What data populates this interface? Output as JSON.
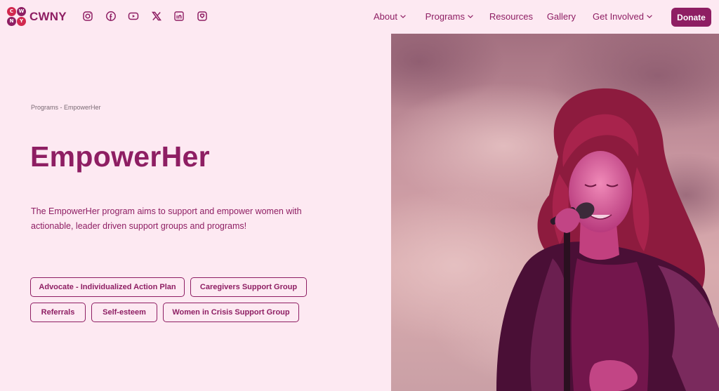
{
  "brand": {
    "name": "CWNY",
    "mark_letters": [
      "C",
      "W",
      "N",
      "Y"
    ],
    "colors": {
      "primary": "#8e1e63",
      "accent": "#d2284e",
      "background": "#fde9f2"
    }
  },
  "socials": [
    {
      "icon": "instagram-icon"
    },
    {
      "icon": "facebook-icon"
    },
    {
      "icon": "youtube-icon"
    },
    {
      "icon": "x-icon"
    },
    {
      "icon": "linkedin-icon"
    },
    {
      "icon": "link-icon"
    }
  ],
  "nav": {
    "items": [
      {
        "label": "About",
        "has_dropdown": true
      },
      {
        "label": "Programs",
        "has_dropdown": true
      },
      {
        "label": "Resources",
        "has_dropdown": false
      },
      {
        "label": "Gallery",
        "has_dropdown": false
      },
      {
        "label": "Get Involved",
        "has_dropdown": true
      }
    ],
    "donate_label": "Donate"
  },
  "page": {
    "breadcrumb": "Programs - EmpowerHer",
    "title": "EmpowerHer",
    "description": "The EmpowerHer program aims to support and empower women with actionable, leader driven support groups and programs!",
    "tags": [
      "Advocate - Individualized Action Plan",
      "Caregivers Support Group",
      "Referrals",
      "Self-esteem",
      "Women in Crisis Support Group"
    ]
  }
}
